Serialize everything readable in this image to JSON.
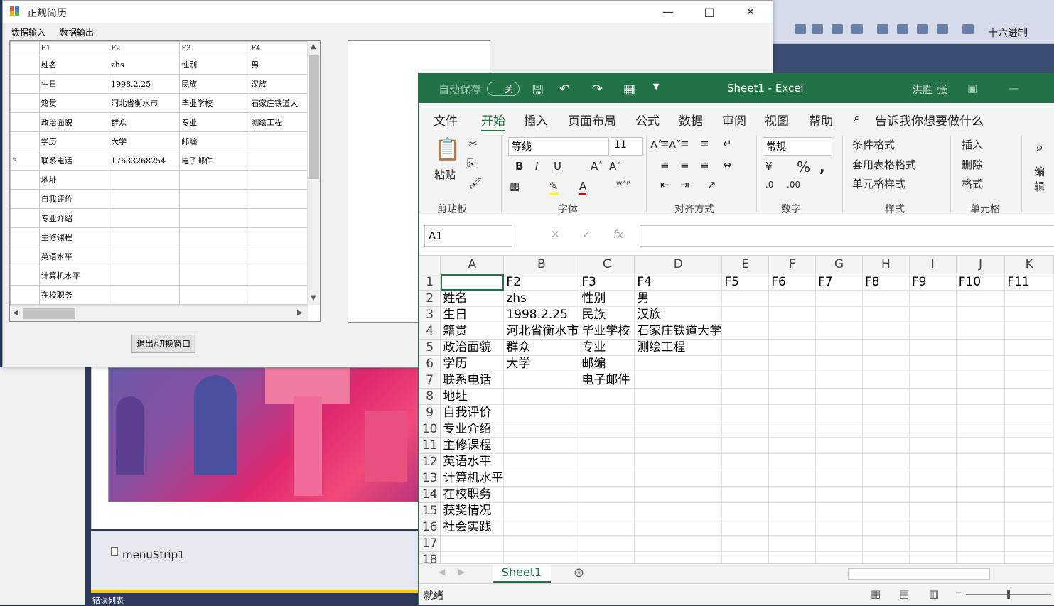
{
  "vs": {
    "hex_label": "十六进制",
    "tray_item": "menuStrip1",
    "bottom_label": "错误列表"
  },
  "form": {
    "title": "正规简历",
    "menus": [
      "数据输入",
      "数据输出"
    ],
    "columns": [
      "F1",
      "F2",
      "F3",
      "F4"
    ],
    "rows": [
      [
        "姓名",
        "zhs",
        "性别",
        "男"
      ],
      [
        "生日",
        "1998.2.25",
        "民族",
        "汉族"
      ],
      [
        "籍贯",
        "河北省衡水市",
        "毕业学校",
        "石家庄铁道大"
      ],
      [
        "政治面貌",
        "群众",
        "专业",
        "测绘工程"
      ],
      [
        "学历",
        "大学",
        "邮编",
        ""
      ],
      [
        "联系电话",
        "17633268254",
        "电子邮件",
        ""
      ],
      [
        "地址",
        "",
        "",
        ""
      ],
      [
        "自我评价",
        "",
        "",
        ""
      ],
      [
        "专业介绍",
        "",
        "",
        ""
      ],
      [
        "主修课程",
        "",
        "",
        ""
      ],
      [
        "英语水平",
        "",
        "",
        ""
      ],
      [
        "计算机水平",
        "",
        "",
        ""
      ],
      [
        "在校职务",
        "",
        "",
        ""
      ]
    ],
    "exit_button": "退出/切换窗口"
  },
  "excel": {
    "autosave": "自动保存",
    "autosave_state": "关",
    "title": "Sheet1  -  Excel",
    "user": "洪胜 张",
    "tabs": [
      "文件",
      "开始",
      "插入",
      "页面布局",
      "公式",
      "数据",
      "审阅",
      "视图",
      "帮助"
    ],
    "tellme": "告诉我你想要做什么",
    "ribbon": {
      "paste": "粘贴",
      "font_name": "等线",
      "font_size": "11",
      "number_format": "常规",
      "cond_format": "条件格式",
      "table_format": "套用表格格式",
      "cell_style": "单元格样式",
      "insert": "插入",
      "delete": "删除",
      "format": "格式",
      "edit": "编辑",
      "groups": [
        "剪贴板",
        "字体",
        "对齐方式",
        "数字",
        "样式",
        "单元格"
      ]
    },
    "namebox": "A1",
    "col_headers": [
      "A",
      "B",
      "C",
      "D",
      "E",
      "F",
      "G",
      "H",
      "I",
      "J",
      "K"
    ],
    "rows": [
      [
        "",
        "F2",
        "F3",
        "F4",
        "F5",
        "F6",
        "F7",
        "F8",
        "F9",
        "F10",
        "F11"
      ],
      [
        "姓名",
        "zhs",
        "性别",
        "男",
        "",
        "",
        "",
        "",
        "",
        "",
        ""
      ],
      [
        "生日",
        "1998.2.25",
        "民族",
        "汉族",
        "",
        "",
        "",
        "",
        "",
        "",
        ""
      ],
      [
        "籍贯",
        "河北省衡水市",
        "毕业学校",
        "石家庄铁道大学",
        "",
        "",
        "",
        "",
        "",
        "",
        ""
      ],
      [
        "政治面貌",
        "群众",
        "专业",
        "测绘工程",
        "",
        "",
        "",
        "",
        "",
        "",
        ""
      ],
      [
        "学历",
        "大学",
        "邮编",
        "",
        "",
        "",
        "",
        "",
        "",
        "",
        ""
      ],
      [
        "联系电话",
        "",
        "电子邮件",
        "",
        "",
        "",
        "",
        "",
        "",
        "",
        ""
      ],
      [
        "地址",
        "",
        "",
        "",
        "",
        "",
        "",
        "",
        "",
        "",
        ""
      ],
      [
        "自我评价",
        "",
        "",
        "",
        "",
        "",
        "",
        "",
        "",
        "",
        ""
      ],
      [
        "专业介绍",
        "",
        "",
        "",
        "",
        "",
        "",
        "",
        "",
        "",
        ""
      ],
      [
        "主修课程",
        "",
        "",
        "",
        "",
        "",
        "",
        "",
        "",
        "",
        ""
      ],
      [
        "英语水平",
        "",
        "",
        "",
        "",
        "",
        "",
        "",
        "",
        "",
        ""
      ],
      [
        "计算机水平",
        "",
        "",
        "",
        "",
        "",
        "",
        "",
        "",
        "",
        ""
      ],
      [
        "在校职务",
        "",
        "",
        "",
        "",
        "",
        "",
        "",
        "",
        "",
        ""
      ],
      [
        "获奖情况",
        "",
        "",
        "",
        "",
        "",
        "",
        "",
        "",
        "",
        ""
      ],
      [
        "社会实践",
        "",
        "",
        "",
        "",
        "",
        "",
        "",
        "",
        "",
        ""
      ],
      [
        "",
        "",
        "",
        "",
        "",
        "",
        "",
        "",
        "",
        "",
        ""
      ],
      [
        "",
        "",
        "",
        "",
        "",
        "",
        "",
        "",
        "",
        "",
        ""
      ]
    ],
    "sheet_tab": "Sheet1",
    "status": "就绪"
  }
}
